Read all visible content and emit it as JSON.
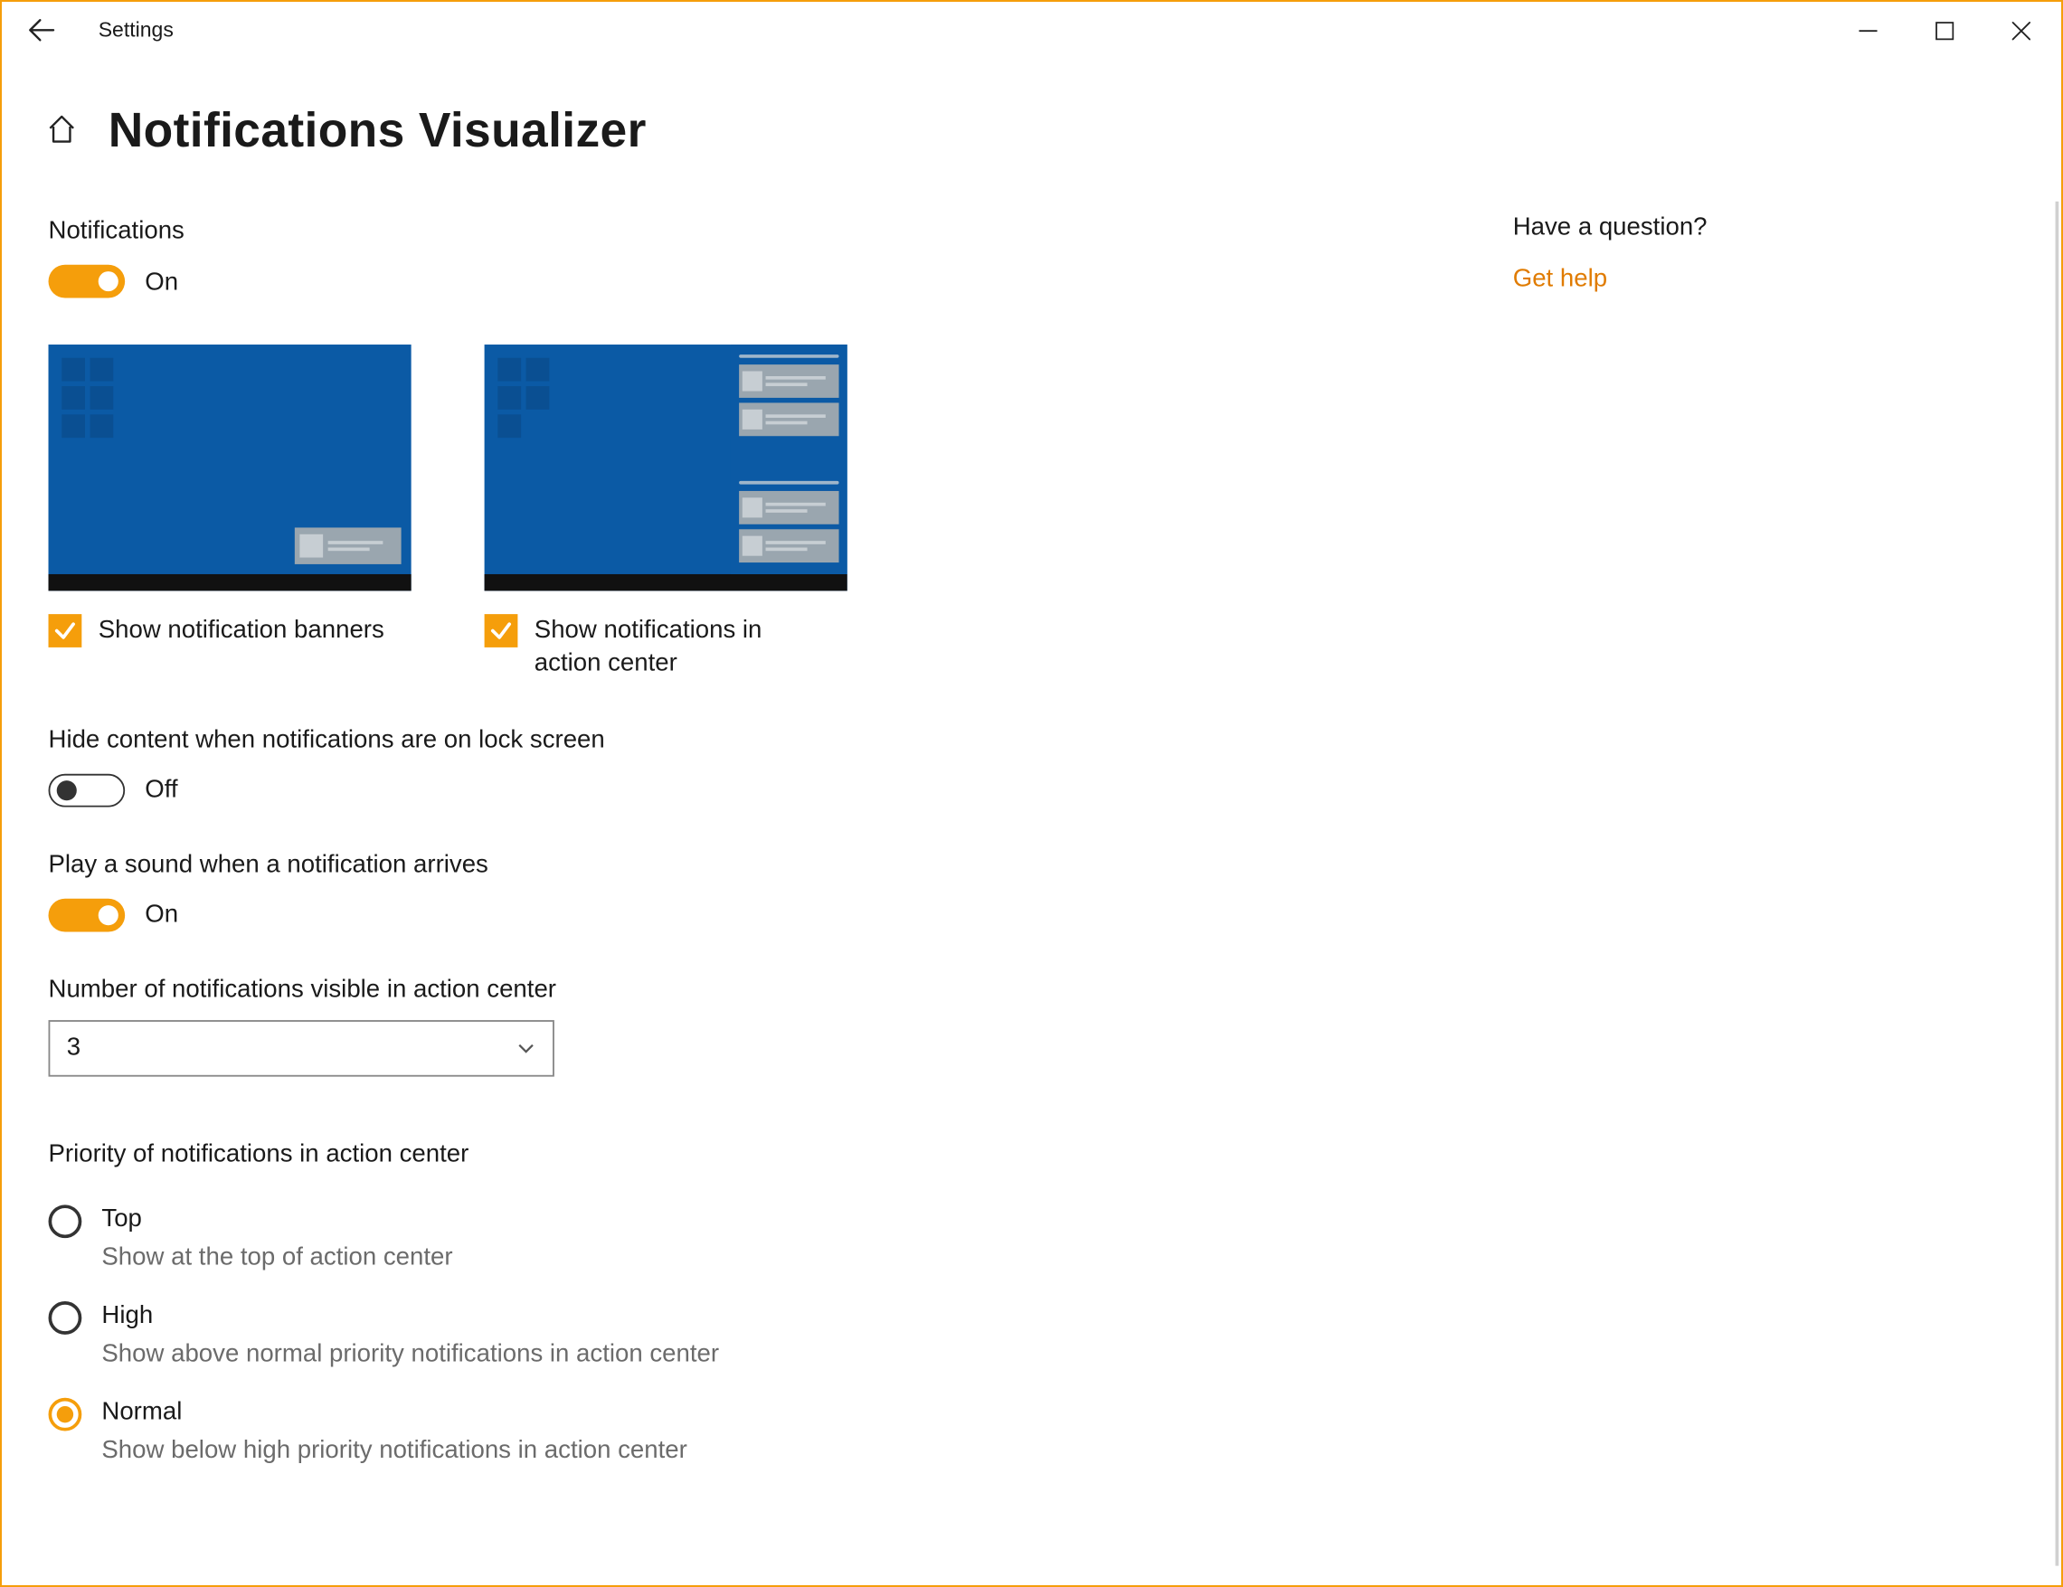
{
  "window": {
    "title": "Settings"
  },
  "page": {
    "title": "Notifications Visualizer"
  },
  "notifications_section": {
    "header": "Notifications",
    "toggle_state": "On"
  },
  "previews": {
    "banner_checkbox_label": "Show notification banners",
    "action_center_checkbox_label": "Show notifications in action center"
  },
  "lock_screen": {
    "label": "Hide content when notifications are on lock screen",
    "toggle_state": "Off"
  },
  "sound": {
    "label": "Play a sound when a notification arrives",
    "toggle_state": "On"
  },
  "visible_count": {
    "label": "Number of notifications visible in action center",
    "value": "3"
  },
  "priority": {
    "header": "Priority of notifications in action center",
    "options": [
      {
        "label": "Top",
        "desc": "Show at the top of action center",
        "checked": false
      },
      {
        "label": "High",
        "desc": "Show above normal priority notifications in action center",
        "checked": false
      },
      {
        "label": "Normal",
        "desc": "Show below high priority notifications in action center",
        "checked": true
      }
    ]
  },
  "aside": {
    "question": "Have a question?",
    "help_link": "Get help"
  }
}
